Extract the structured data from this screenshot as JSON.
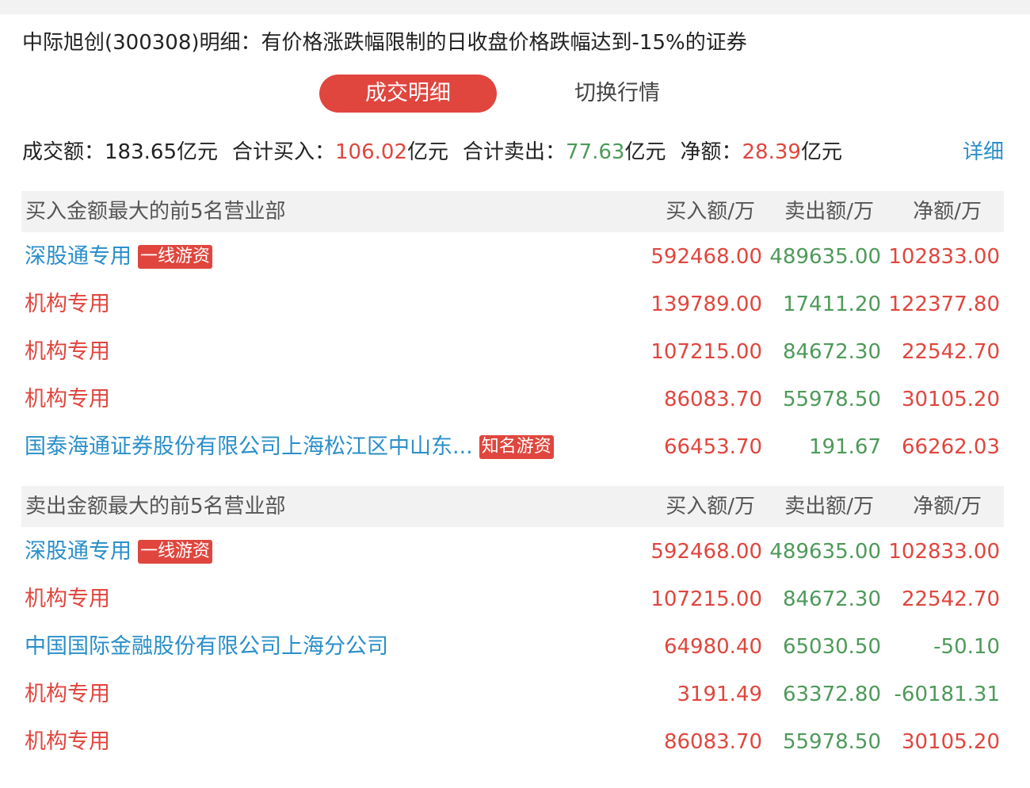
{
  "page": {
    "title": "中际旭创(300308)明细：有价格涨跌幅限制的日收盘价格跌幅达到-15%的证券"
  },
  "tabs": {
    "active": "成交明细",
    "inactive": "切换行情"
  },
  "summary": {
    "turnover_label": "成交额：",
    "turnover_value": "183.65亿元",
    "buy_label": "合计买入：",
    "buy_value": "106.02",
    "buy_unit": "亿元",
    "sell_label": "合计卖出：",
    "sell_value": "77.63",
    "sell_unit": "亿元",
    "net_label": "净额：",
    "net_value": "28.39",
    "net_unit": "亿元",
    "detail_link": "详细"
  },
  "colors": {
    "accent": "#e0463e",
    "up": "#e0463e",
    "down": "#4e9a5a",
    "link": "#2a8fc9"
  },
  "buy_section": {
    "title": "买入金额最大的前5名营业部",
    "col_buy": "买入额/万",
    "col_sell": "卖出额/万",
    "col_net": "净额/万",
    "rows": [
      {
        "name": "深股通专用",
        "badge": "一线游资",
        "buy": "592468.00",
        "sell": "489635.00",
        "net": "102833.00"
      },
      {
        "name": "机构专用",
        "badge": "",
        "buy": "139789.00",
        "sell": "17411.20",
        "net": "122377.80"
      },
      {
        "name": "机构专用",
        "badge": "",
        "buy": "107215.00",
        "sell": "84672.30",
        "net": "22542.70"
      },
      {
        "name": "机构专用",
        "badge": "",
        "buy": "86083.70",
        "sell": "55978.50",
        "net": "30105.20"
      },
      {
        "name": "国泰海通证券股份有限公司上海松江区中山东...",
        "badge": "知名游资",
        "buy": "66453.70",
        "sell": "191.67",
        "net": "66262.03"
      }
    ]
  },
  "sell_section": {
    "title": "卖出金额最大的前5名营业部",
    "col_buy": "买入额/万",
    "col_sell": "卖出额/万",
    "col_net": "净额/万",
    "rows": [
      {
        "name": "深股通专用",
        "badge": "一线游资",
        "buy": "592468.00",
        "sell": "489635.00",
        "net": "102833.00"
      },
      {
        "name": "机构专用",
        "badge": "",
        "buy": "107215.00",
        "sell": "84672.30",
        "net": "22542.70"
      },
      {
        "name": "中国国际金融股份有限公司上海分公司",
        "badge": "",
        "buy": "64980.40",
        "sell": "65030.50",
        "net": "-50.10"
      },
      {
        "name": "机构专用",
        "badge": "",
        "buy": "3191.49",
        "sell": "63372.80",
        "net": "-60181.31"
      },
      {
        "name": "机构专用",
        "badge": "",
        "buy": "86083.70",
        "sell": "55978.50",
        "net": "30105.20"
      }
    ]
  }
}
